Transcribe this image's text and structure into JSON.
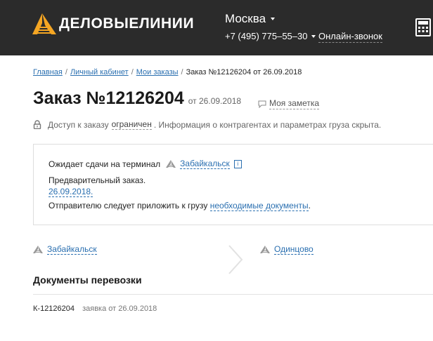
{
  "header": {
    "logo_text": "ДЕЛОВЫЕЛИНИИ",
    "city": "Москва",
    "phone": "+7 (495) 775–55–30",
    "online_call": "Онлайн-звонок",
    "calculator_icon": "calculator-icon"
  },
  "breadcrumbs": [
    {
      "label": "Главная"
    },
    {
      "label": "Личный кабинет"
    },
    {
      "label": "Мои заказы"
    },
    {
      "label": "Заказ №12126204 от 26.09.2018"
    }
  ],
  "order": {
    "title": "Заказ №12126204",
    "date": "от 26.09.2018",
    "note_label": "Моя заметка"
  },
  "access": {
    "prefix": "Доступ к заказу",
    "restricted": "ограничен",
    "suffix": ". Информация о контрагентах и параметрах груза скрыта."
  },
  "status": {
    "awaiting": "Ожидает сдачи на терминал",
    "terminal": "Забайкальск",
    "info_icon": "i",
    "preorder": "Предварительный заказ.",
    "date": "26.09.2018.",
    "sender_text": "Отправителю следует приложить к грузу",
    "docs_link": "необходимые документы",
    "period": "."
  },
  "route": {
    "from": "Забайкальск",
    "to": "Одинцово"
  },
  "documents": {
    "title": "Документы перевозки",
    "items": [
      {
        "number": "К-12126204",
        "description": "заявка от 26.09.2018"
      }
    ]
  },
  "colors": {
    "header_bg": "#2b2b2b",
    "logo_orange": "#f5a623",
    "link": "#2a6fb0"
  }
}
